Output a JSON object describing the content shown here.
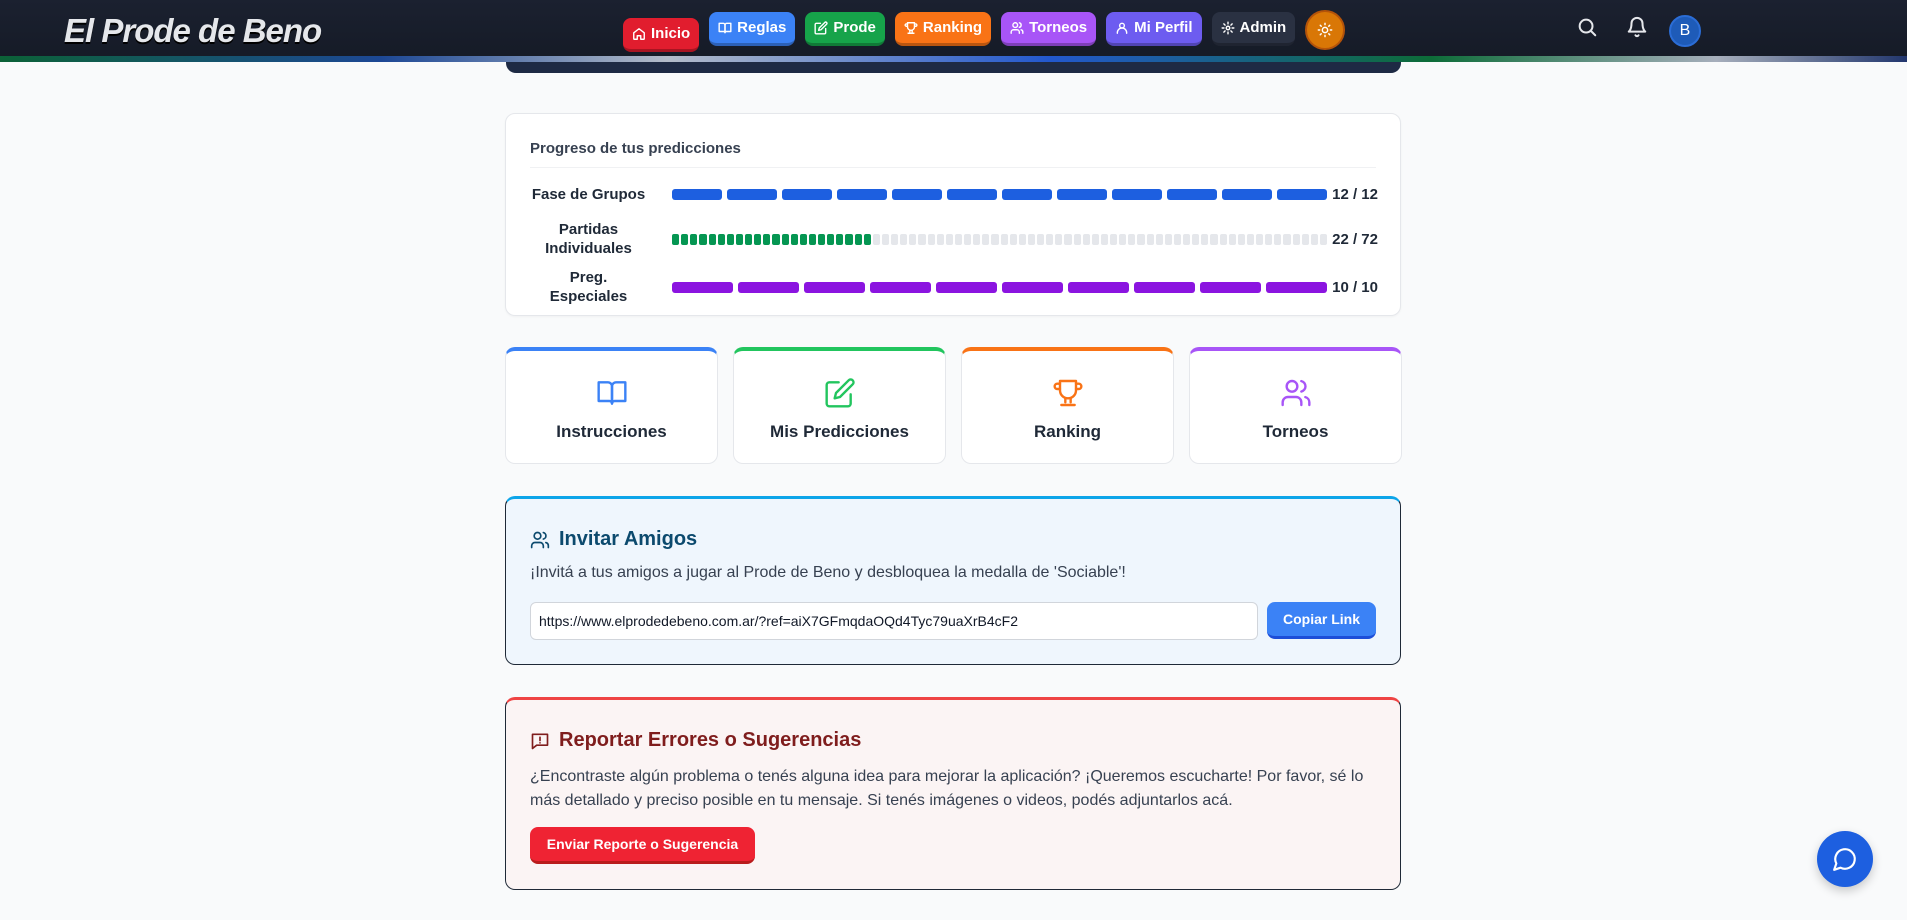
{
  "app": {
    "logo": "El Prode de Beno"
  },
  "nav": {
    "items": [
      {
        "label": "Inicio",
        "icon": "home-icon",
        "color": "#e11d2e"
      },
      {
        "label": "Reglas",
        "icon": "book-icon",
        "color": "#3b82f6"
      },
      {
        "label": "Prode",
        "icon": "edit-icon",
        "color": "#16a34a"
      },
      {
        "label": "Ranking",
        "icon": "trophy-icon",
        "color": "#f97316"
      },
      {
        "label": "Torneos",
        "icon": "users-icon",
        "color": "#a855f7"
      },
      {
        "label": "Mi Perfil",
        "icon": "user-icon",
        "color": "#6d5cf0"
      },
      {
        "label": "Admin",
        "icon": "gear-icon",
        "color": "#2a3142"
      }
    ],
    "theme_icon": "sun-icon",
    "search_icon": "search-icon",
    "bell_icon": "bell-icon",
    "avatar_initial": "B"
  },
  "progress": {
    "title": "Progreso de tus predicciones",
    "rows": [
      {
        "label": "Fase de Grupos",
        "done": 12,
        "total": 12,
        "count": "12 / 12",
        "color": "#1d5fe0"
      },
      {
        "label": "Partidas Individuales",
        "done": 22,
        "total": 72,
        "count": "22 / 72",
        "color": "#059652"
      },
      {
        "label": "Preg. Especiales",
        "done": 10,
        "total": 10,
        "count": "10 / 10",
        "color": "#8b14e0"
      }
    ],
    "empty_color": "#e5e7eb"
  },
  "quick_links": [
    {
      "label": "Instrucciones",
      "icon": "book-open-icon",
      "color": "#3b82f6"
    },
    {
      "label": "Mis Predicciones",
      "icon": "edit-icon",
      "color": "#22c55e"
    },
    {
      "label": "Ranking",
      "icon": "trophy-icon",
      "color": "#f97316"
    },
    {
      "label": "Torneos",
      "icon": "users-icon",
      "color": "#a855f7"
    }
  ],
  "invite": {
    "title": "Invitar Amigos",
    "text": "¡Invitá a tus amigos a jugar al Prode de Beno y desbloquea la medalla de 'Sociable'!",
    "link_value": "https://www.elprodedebeno.com.ar/?ref=aiX7GFmqdaOQd4Tyc79uaXrB4cF2",
    "copy_label": "Copiar Link"
  },
  "report": {
    "title": "Reportar Errores o Sugerencias",
    "text": "¿Encontraste algún problema o tenés alguna idea para mejorar la aplicación? ¡Queremos escucharte! Por favor, sé lo más detallado y preciso posible en tu mensaje. Si tenés imágenes o videos, podés adjuntarlos acá.",
    "button_label": "Enviar Reporte o Sugerencia"
  },
  "chat_icon": "chat-bubble-icon"
}
